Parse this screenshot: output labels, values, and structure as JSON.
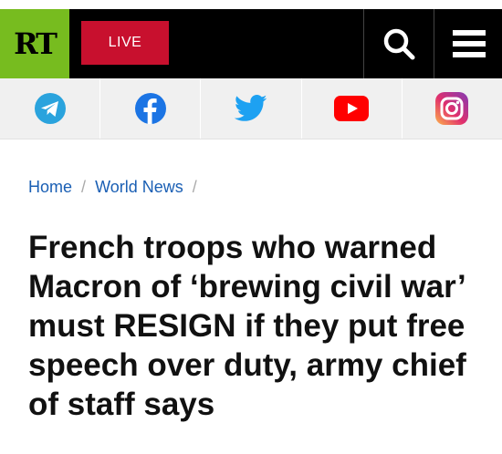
{
  "header": {
    "logo_text": "RT",
    "live_label": "LIVE",
    "search_icon": "search-icon",
    "menu_icon": "hamburger-menu-icon",
    "colors": {
      "logo_bg": "#77bc1f",
      "live_bg": "#c8102e",
      "bar_bg": "#000000"
    }
  },
  "social": [
    {
      "name": "telegram-icon",
      "color": "#2aa3dd"
    },
    {
      "name": "facebook-icon",
      "color": "#1b74e4"
    },
    {
      "name": "twitter-icon",
      "color": "#1da1f2"
    },
    {
      "name": "youtube-icon",
      "color": "#ff0000"
    },
    {
      "name": "instagram-icon",
      "color": "#e1306c"
    }
  ],
  "breadcrumb": {
    "items": [
      "Home",
      "World News"
    ],
    "separator": "/"
  },
  "article": {
    "headline": "French troops who warned Macron of ‘brewing civil war’ must RESIGN if they put free speech over duty, army chief of staff says"
  }
}
